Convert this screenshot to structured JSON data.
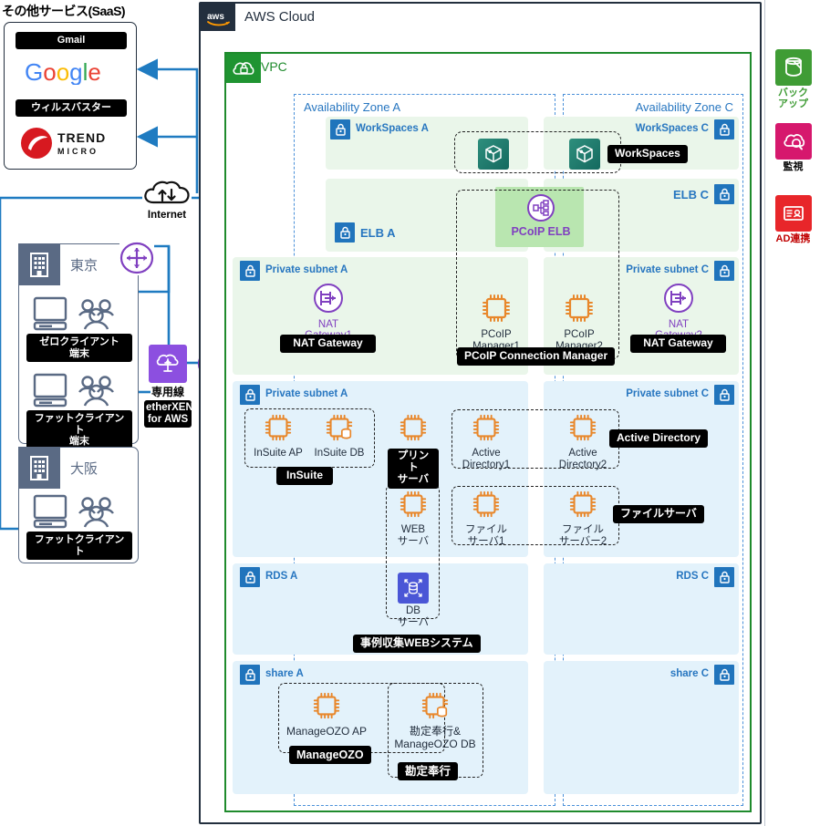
{
  "saas": {
    "title": "その他サービス(SaaS)",
    "items": [
      {
        "tag": "Gmail",
        "logo": "google-logo"
      },
      {
        "tag": "ウィルスバスター",
        "logo": "trend-micro-logo"
      }
    ]
  },
  "internet": {
    "label": "Internet",
    "icon": "internet-cloud-icon"
  },
  "offices": [
    {
      "name": "東京",
      "icon": "building-icon",
      "clients": [
        {
          "label": "ゼロクライアント\n端末",
          "icon": "desktop-users-icon"
        },
        {
          "label": "ファットクライアント\n端末",
          "icon": "desktop-users-icon"
        }
      ]
    },
    {
      "name": "大阪",
      "icon": "building-icon",
      "clients": [
        {
          "label": "ファットクライアント",
          "icon": "desktop-users-icon"
        }
      ]
    }
  ],
  "direct_connect": {
    "icon": "direct-connect-icon",
    "title": "専用線",
    "tag": "etherXEN\nfor AWS"
  },
  "transit": {
    "icon": "transit-gateway-icon"
  },
  "vpn_gateway": {
    "icon": "vpn-gateway-lock-icon"
  },
  "aws": {
    "badge": "aws-logo",
    "title": "AWS Cloud",
    "vpc": {
      "badge": "vpc-icon",
      "title": "VPC"
    },
    "zones": [
      {
        "title": "Availability Zone A",
        "align": "left"
      },
      {
        "title": "Availability Zone C",
        "align": "right"
      }
    ],
    "bands": [
      {
        "id": "workspaces-a",
        "title": "WorkSpaces A",
        "zone": "A",
        "tone": "green"
      },
      {
        "id": "workspaces-c",
        "title": "WorkSpaces C",
        "zone": "C",
        "tone": "green"
      },
      {
        "id": "elb-a",
        "title": "ELB A",
        "zone": "A",
        "tone": "green"
      },
      {
        "id": "elb-c",
        "title": "ELB C",
        "zone": "C",
        "tone": "green"
      },
      {
        "id": "private-subnet-a-1",
        "title": "Private subnet A",
        "zone": "A",
        "tone": "green"
      },
      {
        "id": "private-subnet-c-1",
        "title": "Private subnet C",
        "zone": "C",
        "tone": "green"
      },
      {
        "id": "private-subnet-a-2",
        "title": "Private subnet A",
        "zone": "A",
        "tone": "blue"
      },
      {
        "id": "private-subnet-c-2",
        "title": "Private subnet C",
        "zone": "C",
        "tone": "blue"
      },
      {
        "id": "rds-a",
        "title": "RDS A",
        "zone": "A",
        "tone": "blue"
      },
      {
        "id": "rds-c",
        "title": "RDS C",
        "zone": "C",
        "tone": "blue"
      },
      {
        "id": "share-a",
        "title": "share A",
        "zone": "A",
        "tone": "blue"
      },
      {
        "id": "share-c",
        "title": "share C",
        "zone": "C",
        "tone": "blue"
      }
    ]
  },
  "nodes": {
    "workspaces_a": {
      "icon": "workspaces-icon"
    },
    "workspaces_c": {
      "icon": "workspaces-icon"
    },
    "workspaces_tag": "WorkSpaces",
    "pcoip_elb": {
      "label": "PCoIP ELB",
      "icon": "elb-icon"
    },
    "nat1": {
      "label": "NAT Gateway1",
      "icon": "nat-gateway-icon",
      "tag": "NAT Gateway"
    },
    "nat2": {
      "label": "NAT Gateway2",
      "icon": "nat-gateway-icon",
      "tag": "NAT Gateway"
    },
    "pcoip_mgr1": {
      "label": "PCoIP\nManager1",
      "icon": "ec2-instance-icon"
    },
    "pcoip_mgr2": {
      "label": "PCoIP\nManager2",
      "icon": "ec2-instance-icon"
    },
    "pcoip_cm_tag": "PCoIP Connection Manager",
    "insuite_ap": {
      "label": "InSuite AP",
      "icon": "ec2-instance-icon"
    },
    "insuite_db": {
      "label": "InSuite DB",
      "icon": "ec2-database-icon"
    },
    "insuite_tag": "InSuite",
    "print_server": {
      "label": "",
      "icon": "ec2-instance-icon",
      "tag": "プリント\nサーバ"
    },
    "ad1": {
      "label": "Active\nDirectory1",
      "icon": "ec2-instance-icon"
    },
    "ad2": {
      "label": "Active\nDirectory2",
      "icon": "ec2-instance-icon"
    },
    "ad_tag": "Active Directory",
    "web_server": {
      "label": "WEB\nサーバ",
      "icon": "ec2-instance-icon"
    },
    "file1": {
      "label": "ファイル\nサーバ1",
      "icon": "ec2-instance-icon"
    },
    "file2": {
      "label": "ファイル\nサーバー2",
      "icon": "ec2-instance-icon"
    },
    "file_tag": "ファイルサーバ",
    "db_server": {
      "label": "DB\nサーバ",
      "icon": "rds-icon"
    },
    "web_system_tag": "事例収集WEBシステム",
    "manageozo_ap": {
      "label": "ManageOZO AP",
      "icon": "ec2-instance-icon"
    },
    "kanjo_db": {
      "label": "勘定奉行&\nManageOZO DB",
      "icon": "ec2-database-icon"
    },
    "manageozo_tag": "ManageOZO",
    "kanjo_tag": "勘定奉行"
  },
  "legend": [
    {
      "label": "バック\nアップ",
      "icon": "backup-icon",
      "color": "#3f9c35",
      "text_color": "#3f9c35"
    },
    {
      "label": "監視",
      "icon": "cloudwatch-icon",
      "color": "#d6186d",
      "text_color": "#000000"
    },
    {
      "label": "AD連携",
      "icon": "directory-service-icon",
      "color": "#e8262a",
      "text_color": "#c00000"
    }
  ],
  "colors": {
    "aws_navy": "#232f3e",
    "vpc_green": "#1f8b2d",
    "az_blue": "#2776c0",
    "ec2_orange": "#e8872b",
    "purple": "#8040c0",
    "line_blue": "#1f7bc1"
  }
}
